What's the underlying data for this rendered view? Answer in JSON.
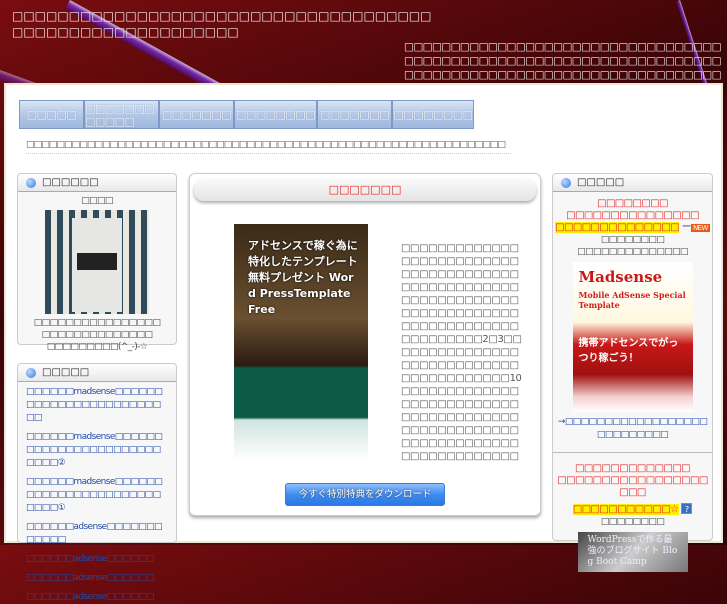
{
  "header": {
    "title": "□□□□□□□□□□□□□□□□□□□□□□□□□□□□□□□□□□□□□□□□□□□□□□□□□□□□□□□□□",
    "tagline": "□□□□□□□□□□□□□□□□□□□□□□□□□□□□□□□□□□□□□□□□□□□□□□□□□□□□□□□□□□□□□□□□□□□□□□□□□□□□□□□□□□□□□□□□□□□□□□□□□□□□□□□□□□□□□□□□□□□□□□□□□□□□□□"
  },
  "nav": [
    {
      "label": "□□□□□"
    },
    {
      "label": "□□□□□□□□□□□□"
    },
    {
      "label": "□□□□□□□"
    },
    {
      "label": "□□□□□□□□"
    },
    {
      "label": "□□□□□□□"
    },
    {
      "label": "□□□□□□□□"
    }
  ],
  "breadcrumb": "□□□□□□□□□□□□□□□□□□□□□□□□□□□□□□□□□□□□□□□□□□□□□□□□□□□□□□□□□□□□□□□",
  "left": {
    "profile": {
      "title": "□□□□□□",
      "caption": "□□□□",
      "lines": [
        "□□□□□□□□□□□□□□□□",
        "□□□□□□□□□□□□□□",
        "□□□□□□□□□(^_-)-☆"
      ]
    },
    "recent": {
      "title": "□□□□□",
      "links": [
        "□□□□□□madsense□□□□□□□□□□□□□□□□□□□□□□□□□",
        "□□□□□□madsense□□□□□□□□□□□□□□□□□□□□□□□□□□□②",
        "□□□□□□madsense□□□□□□□□□□□□□□□□□□□□□□□□□□□①",
        "□□□□□□adsense□□□□□□□□□□□□",
        "□□□□□□adsense□□□□□□",
        "□□□□□□adsense□□□□□□",
        "□□□□□□adsense□□□□□□"
      ]
    }
  },
  "center": {
    "title": "□□□□□□□",
    "image_alt": "アドセンスで稼ぐ為に特化したテンプレート 無料プレゼント Word PressTemplate Free",
    "paragraph": "□□□□□□□□□□□□□□□□□□□□□□□□□□□□□□□□□□□□□□□□□□□□□□□□□□□□□□□□□□□□□□□□□□□□□□□□□□□□□□□□□□□□□□□□□□□□□□□□□□□□2□3□□□□□□□□□□□□□□□□□□□□□□□□□□□□□□□□□□□□□□□□10□□□□□□□□□□□□□□□□□□□□□□□□□□□□□□□□□□□□□□□□□□□□□□□□□□□□□□□□□□□□□□□□□□□□□□□□□□□□□□",
    "download_button": "今すぐ特別特典をダウンロード"
  },
  "right": {
    "title": "□□□□□",
    "promo1": {
      "lines": [
        "□□□□□□□□",
        "□□□□□□□□□□□□□□□"
      ],
      "highlight": "□□□□□□□□□□□□□□",
      "badge": "NEW",
      "sub": [
        "□□□□□□□□",
        "□□□□□□□□□□□□□□"
      ],
      "product": "Madsense",
      "product_sub": "Mobile AdSense Special Template",
      "product_jp": "携帯アドセンスでがっつり稼ごう！",
      "link": "→□□□□□□□□□□□□□□□□□□□□□□□□□□□"
    },
    "promo2": {
      "lines": [
        "□□□□□□□□□□□□□",
        "□□□□□□□□□□□□□□□□□□□□"
      ],
      "highlight": "□□□□□□□□□□□☆",
      "help": "?",
      "sub": "□□□□□□□□",
      "product": "WordPressで作る最強のブログサイト Blog Boot Camp"
    }
  }
}
